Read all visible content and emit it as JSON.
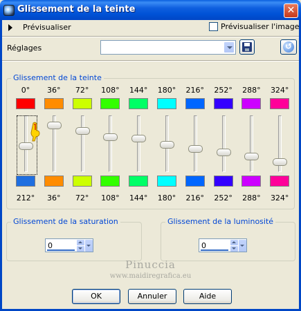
{
  "window": {
    "title": "Glissement de la teinte",
    "close_symbol": "✕"
  },
  "preview": {
    "label": "Prévisualiser",
    "checkbox_label": "Prévisualiser l'image",
    "checkbox_checked": false
  },
  "settings": {
    "label": "Réglages",
    "value": ""
  },
  "hue_group": {
    "title": "Glissement de la teinte",
    "channels": [
      {
        "top_label": "0°",
        "top_color": "#ff0000",
        "bottom_label": "212°",
        "bottom_color": "#1f6fe0",
        "shift_degrees": 212
      },
      {
        "top_label": "36°",
        "top_color": "#ff8c00",
        "bottom_label": "36°",
        "bottom_color": "#ff8c00",
        "shift_degrees": 0
      },
      {
        "top_label": "72°",
        "top_color": "#ccff00",
        "bottom_label": "72°",
        "bottom_color": "#ccff00",
        "shift_degrees": 0
      },
      {
        "top_label": "108°",
        "top_color": "#33ff00",
        "bottom_label": "108°",
        "bottom_color": "#33ff00",
        "shift_degrees": 0
      },
      {
        "top_label": "144°",
        "top_color": "#00ff66",
        "bottom_label": "144°",
        "bottom_color": "#00ff66",
        "shift_degrees": 0
      },
      {
        "top_label": "180°",
        "top_color": "#00ffff",
        "bottom_label": "180°",
        "bottom_color": "#00ffff",
        "shift_degrees": 0
      },
      {
        "top_label": "216°",
        "top_color": "#0066ff",
        "bottom_label": "216°",
        "bottom_color": "#0066ff",
        "shift_degrees": 0
      },
      {
        "top_label": "252°",
        "top_color": "#3300ff",
        "bottom_label": "252°",
        "bottom_color": "#3300ff",
        "shift_degrees": 0
      },
      {
        "top_label": "288°",
        "top_color": "#cc00ff",
        "bottom_label": "288°",
        "bottom_color": "#cc00ff",
        "shift_degrees": 0
      },
      {
        "top_label": "324°",
        "top_color": "#ff0099",
        "bottom_label": "324°",
        "bottom_color": "#ff0099",
        "shift_degrees": 0
      }
    ],
    "slider_levels": [
      0.55,
      0.12,
      0.24,
      0.36,
      0.4,
      0.52,
      0.6,
      0.68,
      0.76,
      0.88
    ]
  },
  "saturation": {
    "title": "Glissement de la saturation",
    "value": "0"
  },
  "luminosity": {
    "title": "Glissement de la luminosité",
    "value": "0"
  },
  "watermark": {
    "line1": "Pinuccia",
    "line2": "www.maidiregrafica.eu"
  },
  "buttons": {
    "ok": "OK",
    "cancel": "Annuler",
    "help": "Aide"
  }
}
